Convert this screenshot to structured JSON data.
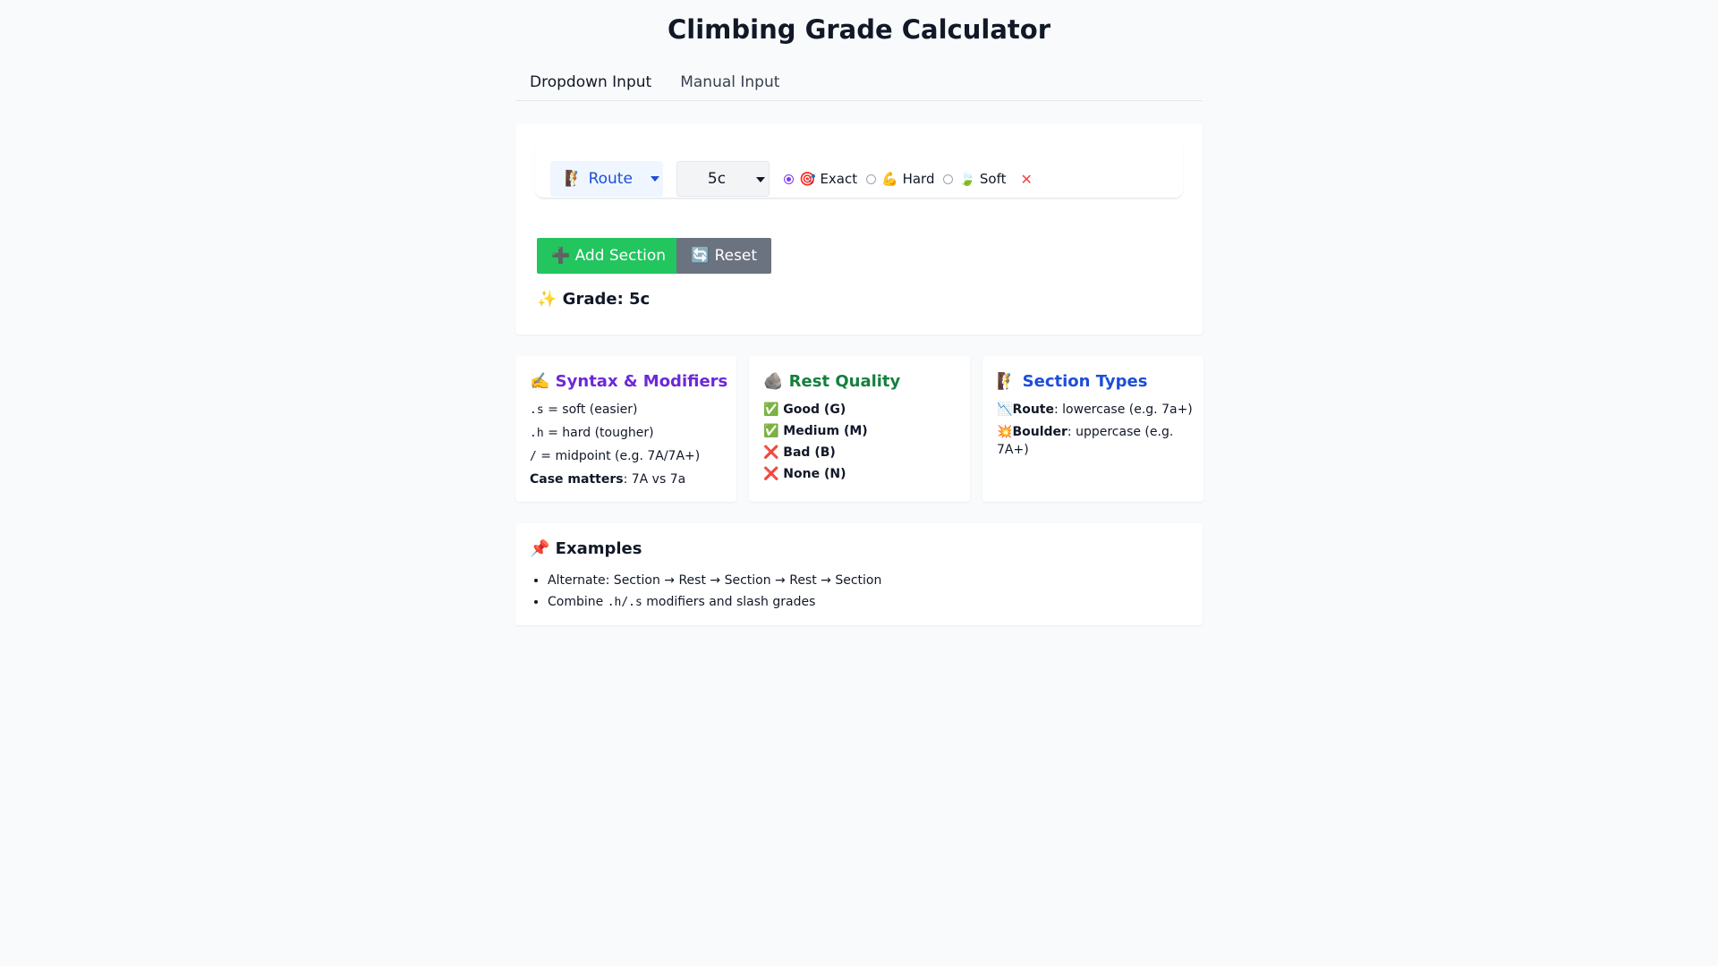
{
  "header": {
    "title": "Climbing Grade Calculator"
  },
  "tabs": [
    {
      "label": "Dropdown Input",
      "active": true
    },
    {
      "label": "Manual Input",
      "active": false
    }
  ],
  "section": {
    "type_value": "🧗 Route",
    "grade_value": "5c",
    "modifiers": [
      {
        "label": "🎯 Exact",
        "checked": true
      },
      {
        "label": "💪 Hard",
        "checked": false
      },
      {
        "label": "🍃 Soft",
        "checked": false
      }
    ],
    "remove_label": "✕"
  },
  "buttons": {
    "add_label": "➕ Add Section",
    "reset_label": "🔄 Reset"
  },
  "result": {
    "text": "✨ Grade: 5c"
  },
  "syntax_card": {
    "title": "✍️ Syntax & Modifiers",
    "items": [
      {
        "code": ".s",
        "text": " = soft (easier)"
      },
      {
        "code": ".h",
        "text": " = hard (tougher)"
      },
      {
        "code": "/",
        "text": " = midpoint (e.g. 7A/7A+)"
      },
      {
        "bold": "Case matters",
        "text": ": 7A vs 7a"
      }
    ]
  },
  "rest_card": {
    "title": "🪨 Rest Quality",
    "items": [
      "✅ Good (G)",
      "✅ Medium (M)",
      "❌ Bad (B)",
      "❌ None (N)"
    ]
  },
  "types_card": {
    "title": "🧗 Section Types",
    "items": [
      {
        "icon": "📉",
        "bold": "Route",
        "text": ": lowercase (e.g. 7a+)"
      },
      {
        "icon": "💥",
        "bold": "Boulder",
        "text": ": uppercase (e.g. 7A+)"
      }
    ]
  },
  "examples": {
    "title": "📌 Examples",
    "item1": "Alternate: Section → Rest → Section → Rest → Section",
    "item2_pre": "Combine ",
    "item2_code": ".h/.s",
    "item2_post": " modifiers and slash grades"
  },
  "colors": {
    "accent_purple": "#7c3aed",
    "add_green": "#22c55e",
    "reset_gray": "#6b7280",
    "route_blue": "#1d4ed8"
  }
}
